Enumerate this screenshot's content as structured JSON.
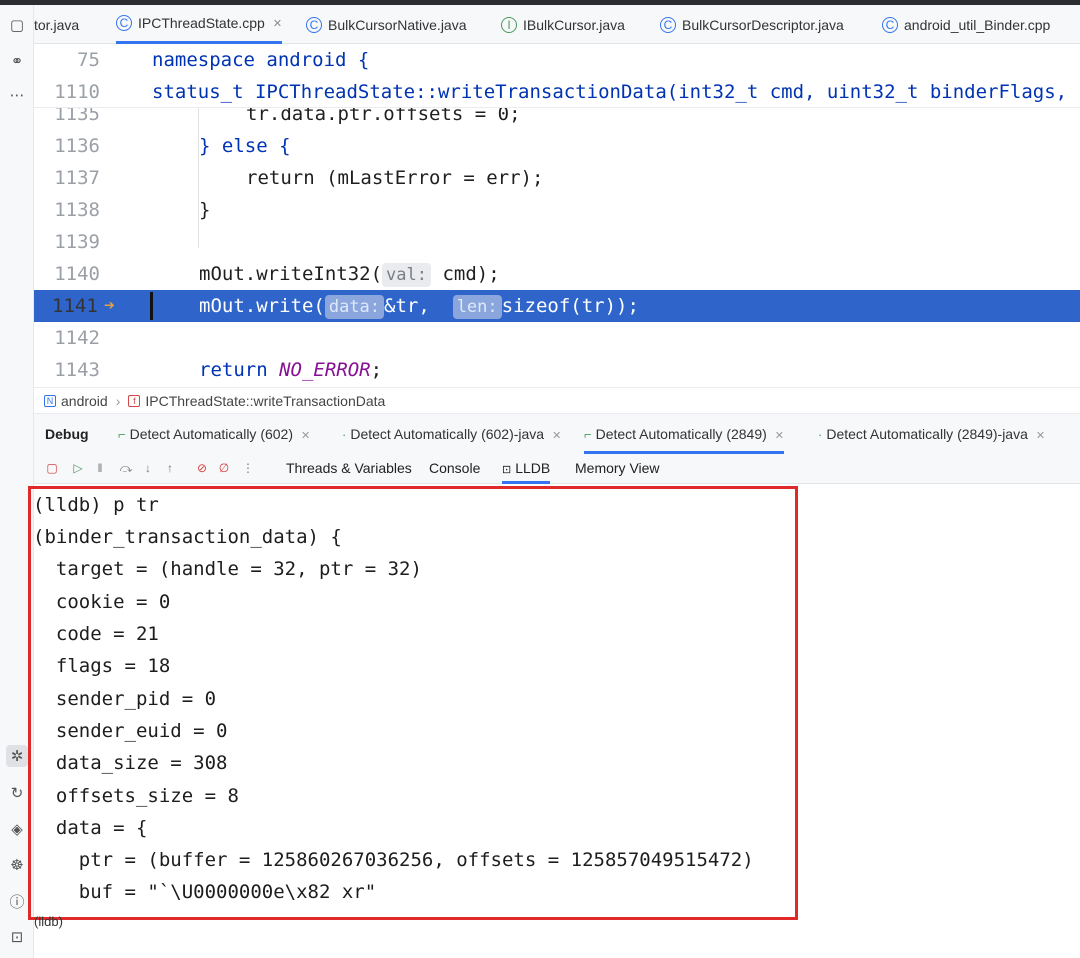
{
  "tabs": [
    {
      "label": "tor.java",
      "icon": "java-class-icon",
      "active": false
    },
    {
      "label": "IPCThreadState.cpp",
      "icon": "cpp-file-icon",
      "active": true
    },
    {
      "label": "BulkCursorNative.java",
      "icon": "java-class-icon",
      "active": false
    },
    {
      "label": "IBulkCursor.java",
      "icon": "java-interface-icon",
      "active": false
    },
    {
      "label": "BulkCursorDescriptor.java",
      "icon": "java-class-icon",
      "active": false
    },
    {
      "label": "android_util_Binder.cpp",
      "icon": "cpp-file-icon",
      "active": false
    }
  ],
  "editor": {
    "sticky": [
      {
        "ln": "75",
        "code": "namespace android {"
      },
      {
        "ln": "1110",
        "code": "status_t IPCThreadState::writeTransactionData(int32_t cmd, uint32_t binderFlags,"
      }
    ],
    "lines": [
      {
        "ln": "1135",
        "code": "tr.data.ptr.offsets = 0;"
      },
      {
        "ln": "1136",
        "code": "} else {"
      },
      {
        "ln": "1137",
        "code": "return (mLastError = err);"
      },
      {
        "ln": "1138",
        "code": "}"
      },
      {
        "ln": "1139",
        "code": ""
      },
      {
        "ln": "1140",
        "code": "mOut.writeInt32(",
        "hint": "val:",
        "tail": "cmd);"
      },
      {
        "ln": "1141",
        "code": "mOut.write(",
        "hint1": "data:",
        "mid": "&tr,",
        "hint2": "len:",
        "tail": "sizeof(tr));"
      },
      {
        "ln": "1142",
        "code": ""
      },
      {
        "ln": "1143",
        "code": "return ",
        "italic": "NO_ERROR",
        "tail": ";"
      }
    ]
  },
  "breadcrumb": {
    "items": [
      "android",
      "IPCThreadState::writeTransactionData"
    ]
  },
  "debug": {
    "title": "Debug",
    "sessions": [
      {
        "label": "Detect Automatically (602)"
      },
      {
        "label": "Detect Automatically (602)-java"
      },
      {
        "label": "Detect Automatically (2849)",
        "active": true
      },
      {
        "label": "Detect Automatically (2849)-java"
      }
    ],
    "subtabs": [
      "Threads & Variables",
      "Console",
      "LLDB",
      "Memory View"
    ],
    "active_subtab": "LLDB"
  },
  "console": {
    "lines": [
      "(lldb) p tr",
      "(binder_transaction_data) {",
      "  target = (handle = 32, ptr = 32)",
      "  cookie = 0",
      "  code = 21",
      "  flags = 18",
      "  sender_pid = 0",
      "  sender_euid = 0",
      "  data_size = 308",
      "  offsets_size = 8",
      "  data = {",
      "    ptr = (buffer = 125860267036256, offsets = 125857049515472)",
      "    buf = \"`\\U0000000e\\x82 xr\""
    ],
    "prompt": "(lldb)"
  },
  "colors": {
    "accent": "#3574f0",
    "execution_line": "#2f65ca",
    "highlight_border": "#e02a2a"
  }
}
